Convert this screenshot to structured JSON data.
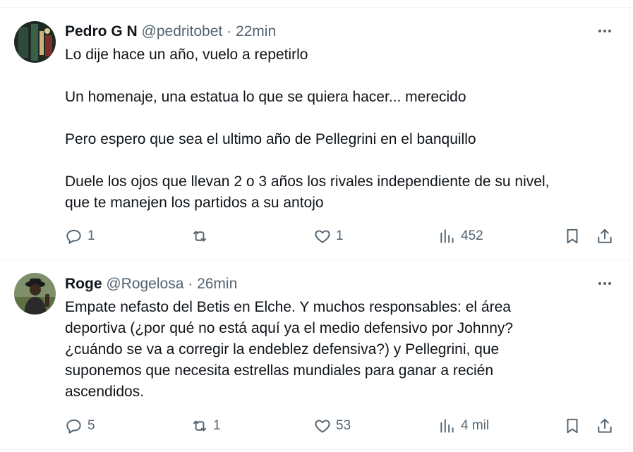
{
  "tweets": [
    {
      "name": "Pedro G N",
      "handle": "@pedritobet",
      "separator": "·",
      "time": "22min",
      "paragraphs": [
        "Lo dije hace un año, vuelo a repetirlo",
        "Un homenaje, una estatua lo que se quiera hacer... merecido",
        "Pero espero que sea el ultimo año de Pellegrini en el banquillo",
        "Duele los ojos que llevan 2 o 3 años los rivales independiente de su nivel,\nque te manejen los partidos a su antojo"
      ],
      "replies": "1",
      "retweets": "",
      "likes": "1",
      "views": "452"
    },
    {
      "name": "Roge",
      "handle": "@Rogelosa",
      "separator": "·",
      "time": "26min",
      "paragraphs": [
        "Empate nefasto del Betis en Elche. Y muchos responsables: el área\ndeportiva (¿por qué no está aquí ya el medio defensivo por Johnny?\n¿cuándo se va a corregir la endeblez defensiva?) y Pellegrini, que\nsuponemos que necesita estrellas mundiales para  ganar a recién\nascendidos."
      ],
      "replies": "5",
      "retweets": "1",
      "likes": "53",
      "views": "4 mil"
    }
  ]
}
